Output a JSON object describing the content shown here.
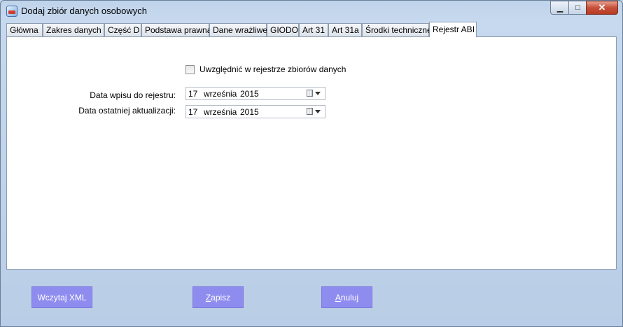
{
  "window": {
    "title": "Dodaj zbiór danych osobowych",
    "min_icon": "minimize-icon",
    "max_icon": "maximize-icon",
    "close_icon": "close-icon"
  },
  "tabs": [
    {
      "label": "Główna"
    },
    {
      "label": "Zakres danych"
    },
    {
      "label": "Część D"
    },
    {
      "label": "Podstawa prawna"
    },
    {
      "label": "Dane wrażliwe"
    },
    {
      "label": "GIODO"
    },
    {
      "label": "Art 31"
    },
    {
      "label": "Art 31a"
    },
    {
      "label": "Środki techniczne"
    },
    {
      "label": "Rejestr ABI"
    }
  ],
  "active_tab": "Rejestr ABI",
  "form": {
    "checkbox_label": "Uwzględnić w rejestrze zbiorów danych",
    "checkbox_checked": false,
    "entry_date_label": "Data wpisu do rejestru:",
    "entry_date": {
      "day": "17",
      "month": "września",
      "year": "2015"
    },
    "update_date_label": "Data ostatniej aktualizacji:",
    "update_date": {
      "day": "17",
      "month": "września",
      "year": "2015"
    }
  },
  "buttons": {
    "load_xml": "Wczytaj XML",
    "save": "Zapisz",
    "cancel": "Anuluj"
  },
  "colors": {
    "button_bg": "#8f8cf0",
    "close_bg": "#c7503a"
  }
}
